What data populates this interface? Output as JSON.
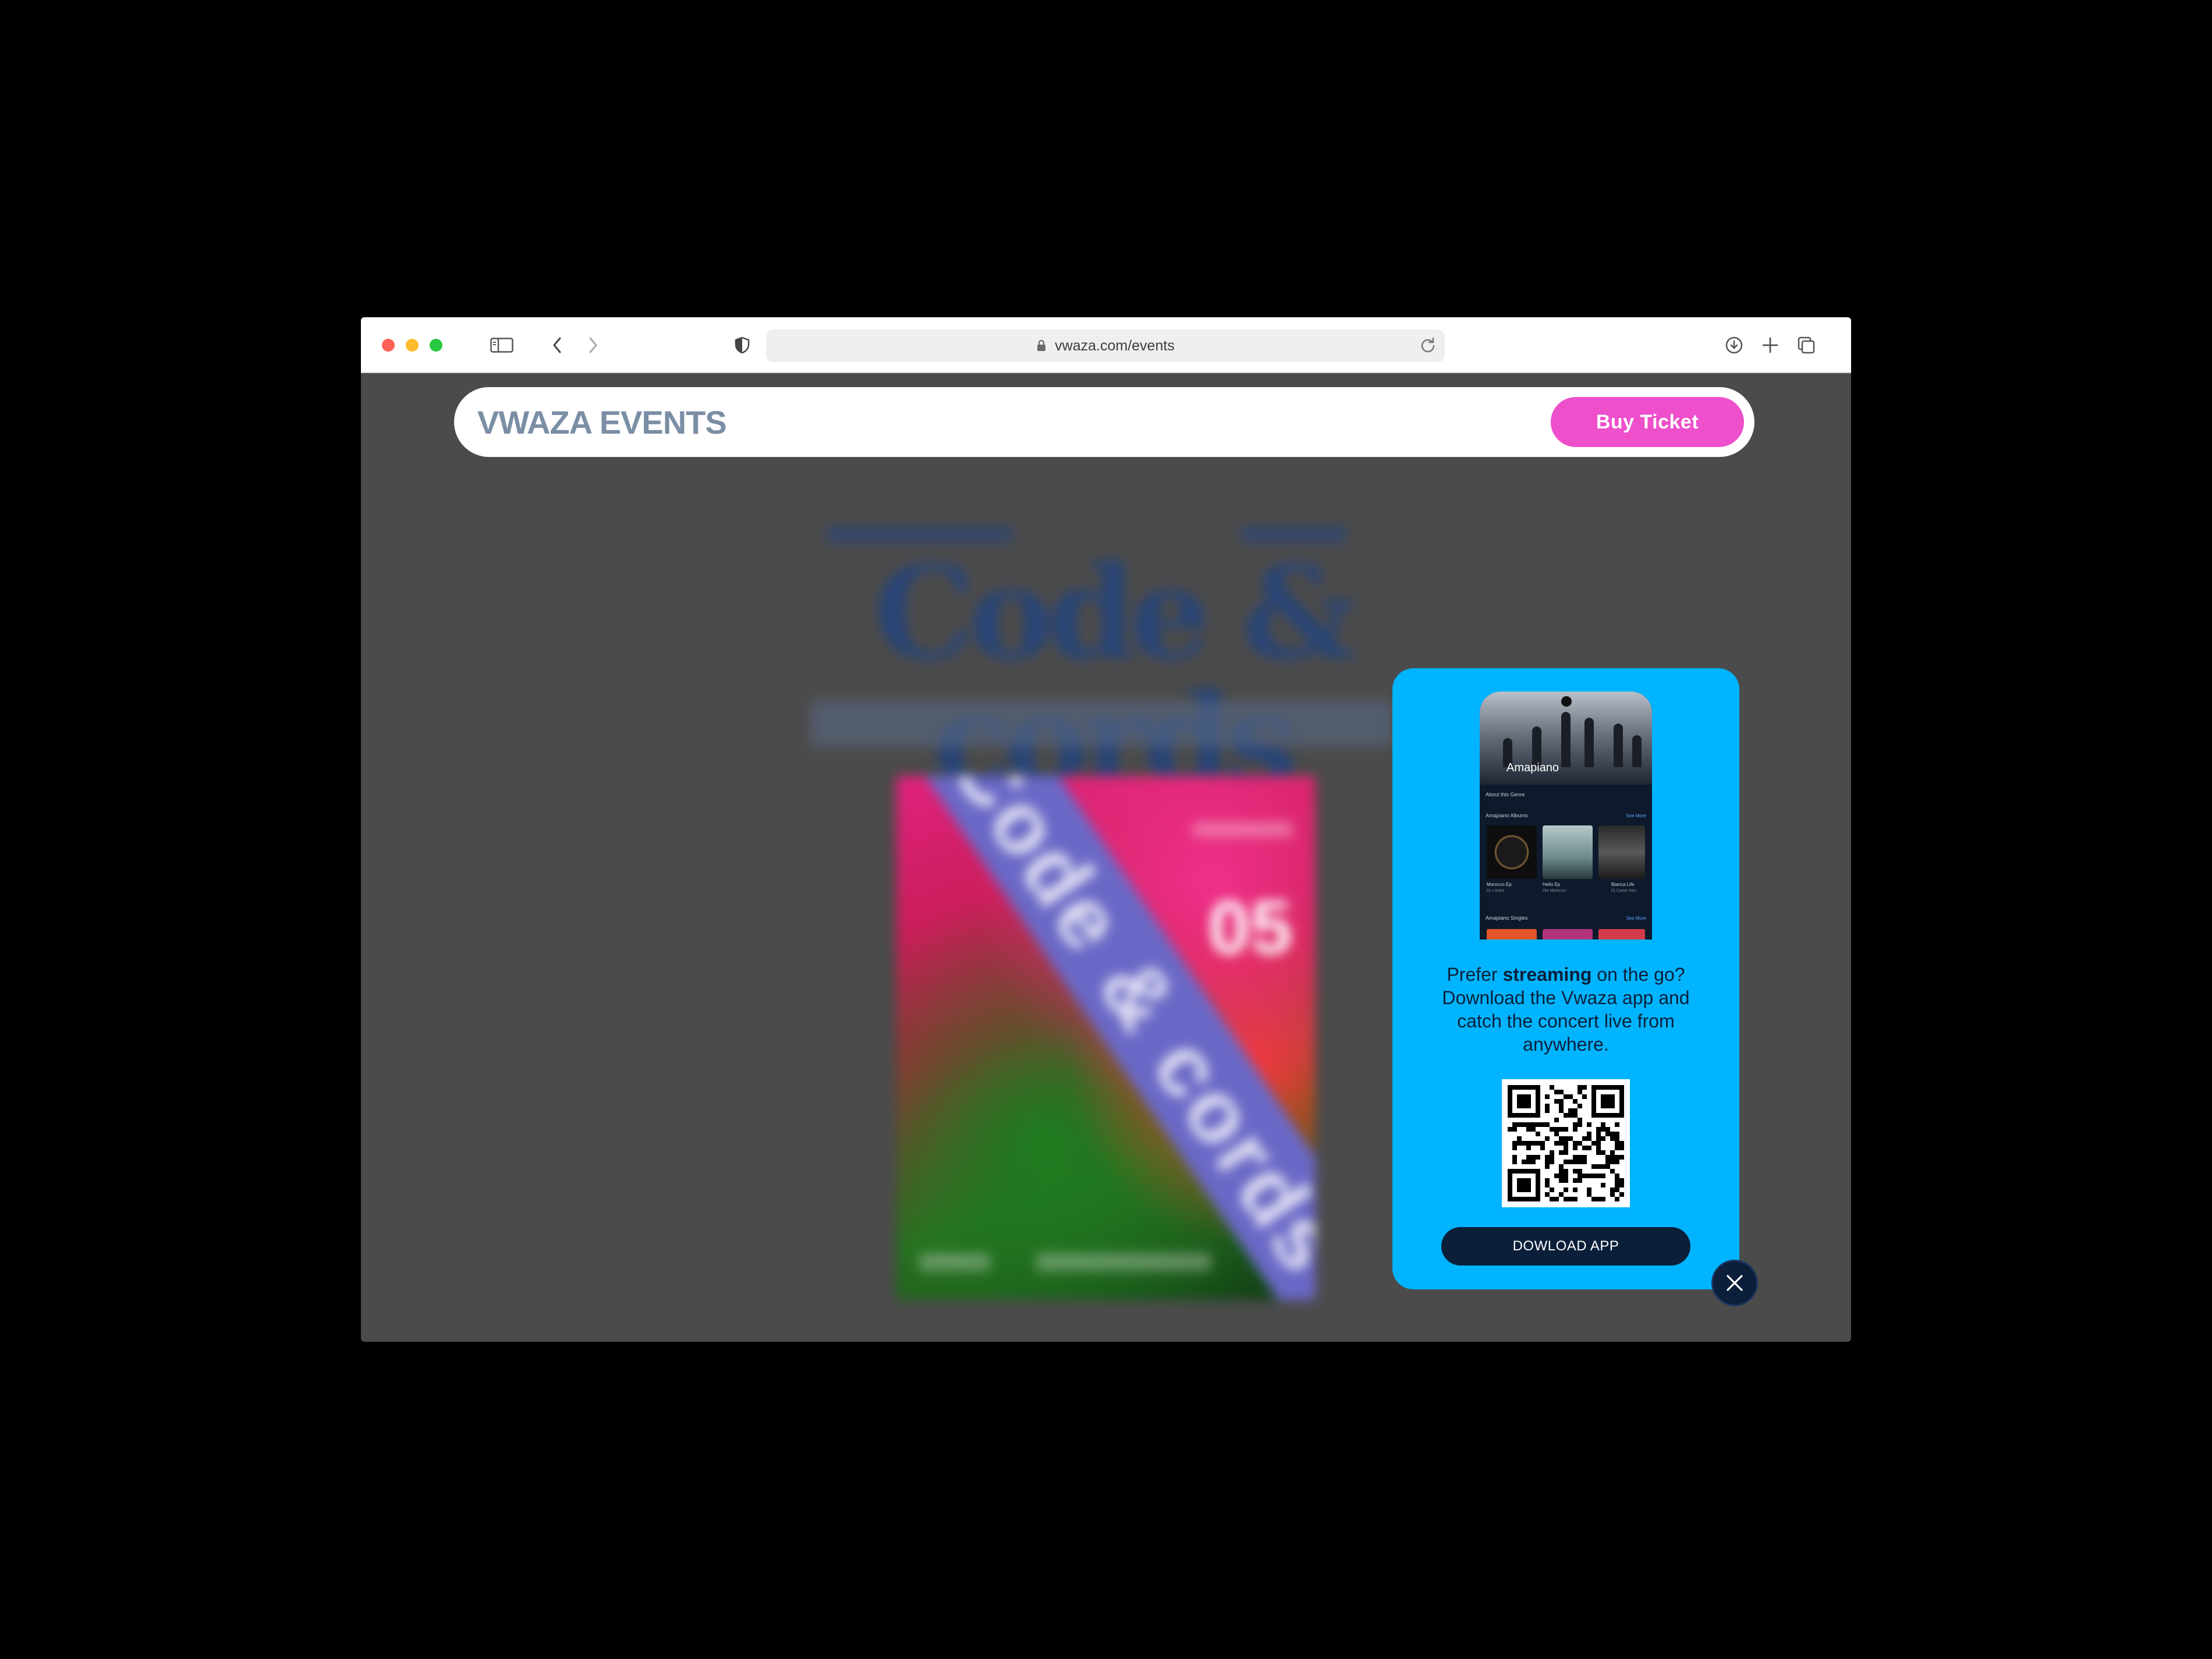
{
  "browser": {
    "url": "vwaza.com/events",
    "icons": {
      "sidebar": "sidebar-icon",
      "back": "chevron-left-icon",
      "forward": "chevron-right-icon",
      "shield": "shield-icon",
      "lock": "lock-icon",
      "reload": "reload-icon",
      "download": "download-icon",
      "new_tab": "plus-icon",
      "tabs": "tabs-overview-icon"
    }
  },
  "navbar": {
    "brand": "VWAZA EVENTS",
    "buy_button": "Buy Ticket"
  },
  "hero": {
    "title": "Code & cords",
    "poster_number": "05"
  },
  "popup": {
    "phone": {
      "title": "Amapiano",
      "section_about": "About this Genre",
      "section_albums": "Amapiano Albums",
      "see_more": "See More",
      "albums": [
        {
          "name": "Morocco Ep",
          "artist": "Dj x Artist"
        },
        {
          "name": "Hello Ep",
          "artist": "Dlo Mjolonzo"
        },
        {
          "name": "Bianca Life",
          "artist": "Dj Carter Alex"
        }
      ],
      "section_singles": "Amapiano Singles"
    },
    "message_pre": "Prefer ",
    "message_bold": "streaming",
    "message_post": " on the go? Download the Vwaza app and catch the concert live from anywhere.",
    "download_button": "DOWLOAD APP",
    "close_icon": "close-icon"
  },
  "colors": {
    "accent_pink": "#ee4fcb",
    "popup_blue": "#00b4ff",
    "navy": "#0b1f3a",
    "brand_gray": "#7a8ea5"
  }
}
